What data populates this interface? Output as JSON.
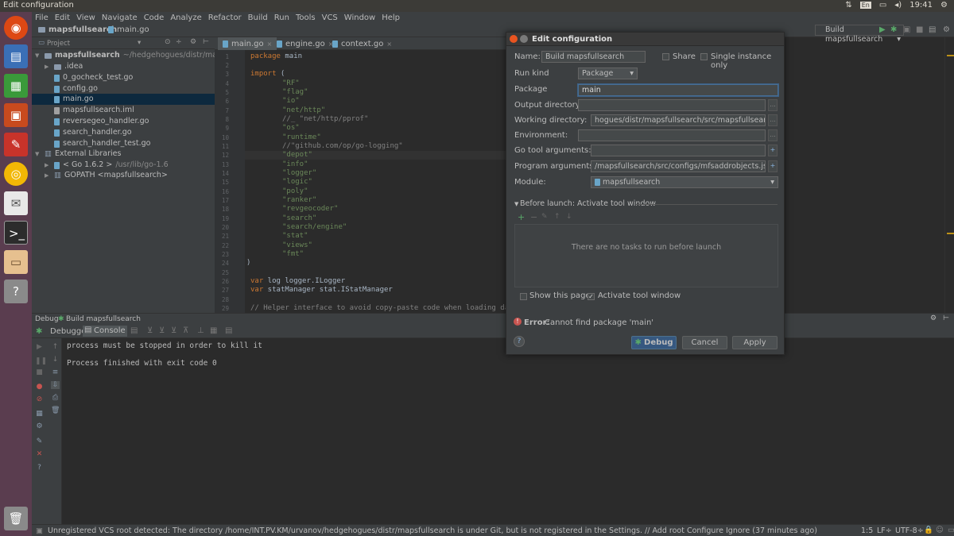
{
  "window": {
    "title": "Edit configuration",
    "clock": "19:41",
    "lang": "En"
  },
  "menu": [
    "File",
    "Edit",
    "View",
    "Navigate",
    "Code",
    "Analyze",
    "Refactor",
    "Build",
    "Run",
    "Tools",
    "VCS",
    "Window",
    "Help"
  ],
  "breadcrumb": {
    "project": "mapsfullsearch",
    "file": "main.go"
  },
  "run_config": "Build mapsfullsearch",
  "project_panel": {
    "header": "Project",
    "root_name": "mapsfullsearch",
    "root_path": "~/hedgehogues/distr/mapsfull",
    "items": [
      ".idea",
      "0_gocheck_test.go",
      "config.go",
      "main.go",
      "mapsfullsearch.iml",
      "reversegeo_handler.go",
      "search_handler.go",
      "search_handler_test.go"
    ],
    "external": "External Libraries",
    "go_sdk": "< Go 1.6.2 >",
    "go_sdk_path": " /usr/lib/go-1.6",
    "gopath": "GOPATH <mapsfullsearch>"
  },
  "tabs": [
    "main.go",
    "engine.go",
    "context.go"
  ],
  "code": {
    "line_numbers": [
      "1",
      "2",
      "3",
      "4",
      "5",
      "6",
      "7",
      "8",
      "9",
      "10",
      "11",
      "12",
      "13",
      "14",
      "15",
      "16",
      "17",
      "18",
      "19",
      "20",
      "21",
      "22",
      "23",
      "24",
      "25",
      "26",
      "27",
      "28",
      "29"
    ],
    "l1_kw": "package",
    "l1_rest": " main",
    "l3_kw": "import",
    "l3_rest": " (",
    "imports": [
      "\"RF\"",
      "\"flag\"",
      "\"io\"",
      "\"net/http\"",
      "//_ \"net/http/pprof\"",
      "\"os\"",
      "\"runtime\"",
      "//\"github.com/op/go-logging\"",
      "\"depot\"",
      "\"info\"",
      "\"logger\"",
      "\"logic\"",
      "\"poly\"",
      "\"ranker\"",
      "\"revgeocoder\"",
      "\"search\"",
      "\"search/engine\"",
      "\"stat\"",
      "\"views\"",
      "\"fmt\""
    ],
    "close_paren": ")",
    "l26_kw": "var",
    "l26_rest": " log logger.ILogger",
    "l27_kw": "var",
    "l27_rest": " statManager stat.IStatManager",
    "l29": "// Helper interface to avoid copy-paste code when loading data f"
  },
  "debug": {
    "header_label": "Debug",
    "header_config": "Build mapsfullsearch",
    "tab_debugger": "Debugger",
    "tab_console": "Console",
    "console_lines": [
      "process must be stopped in order to kill it",
      "",
      "Process finished with exit code 0"
    ]
  },
  "status_bar": {
    "message": "Unregistered VCS root detected: The directory /home/INT.PV.KM/urvanov/hedgehogues/distr/mapsfullsearch is under Git, but is not registered in the Settings. // Add root  Configure  Ignore (37 minutes ago)",
    "position": "1:5",
    "line_sep": "LF÷",
    "encoding": "UTF-8÷"
  },
  "dialog": {
    "title": "Edit configuration",
    "name_label": "Name:",
    "name_value": "Build mapsfullsearch",
    "share_label": "Share",
    "single_label": "Single instance only",
    "runkind_label": "Run kind",
    "runkind_value": "Package",
    "package_label": "Package",
    "package_value": "main",
    "outdir_label": "Output directory",
    "workdir_label": "Working directory:",
    "workdir_value": "hogues/distr/mapsfullsearch/src/mapsfullsearch",
    "env_label": "Environment:",
    "goargs_label": "Go tool arguments:",
    "progargs_label": "Program arguments:",
    "progargs_value": "/mapsfullsearch/src/configs/mfsaddrobjects.json",
    "module_label": "Module:",
    "module_value": "mapsfullsearch",
    "before_launch": "Before launch: Activate tool window",
    "no_tasks": "There are no tasks to run before launch",
    "show_page": "Show this page",
    "activate_tool": "Activate tool window",
    "error_label": "Error:",
    "error_text": " Cannot find package 'main'",
    "btn_debug": "Debug",
    "btn_cancel": "Cancel",
    "btn_apply": "Apply",
    "help": "?",
    "ellipsis": "...",
    "plus": "+"
  },
  "colors": {
    "launcher": "#5a3d4f",
    "ide_bg": "#2b2b2b",
    "panel": "#3c3f41",
    "accent": "#365880",
    "error": "#c75450"
  }
}
